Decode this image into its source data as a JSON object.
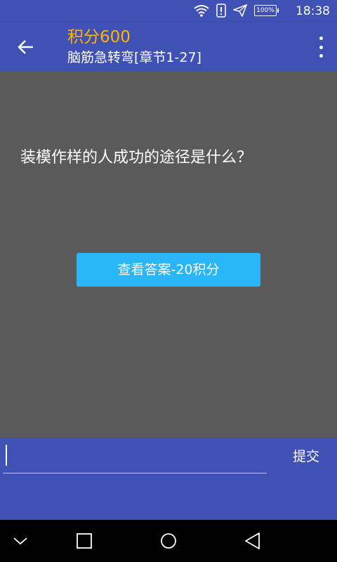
{
  "status_bar": {
    "time": "18:38",
    "battery": "100%",
    "icons": [
      "wifi-icon",
      "alert-icon",
      "send-icon",
      "battery-icon"
    ]
  },
  "toolbar": {
    "score_label": "积分",
    "score_value": "600",
    "subtitle": "脑筋急转弯[章节1-27]",
    "back_icon": "back-arrow-icon",
    "menu_icon": "more-vert-icon"
  },
  "main": {
    "question": "装模作样的人成功的途径是什么？",
    "show_answer_label": "查看答案-20积分"
  },
  "answer_bar": {
    "input_value": "",
    "submit_label": "提交"
  },
  "nav_bar": {
    "icons": [
      "collapse-icon",
      "recents-icon",
      "home-icon",
      "back-icon"
    ]
  },
  "colors": {
    "primary": "#3f51b5",
    "content_bg": "#5a5a5a",
    "accent_button": "#29b6f6",
    "score": "#ffb300"
  }
}
